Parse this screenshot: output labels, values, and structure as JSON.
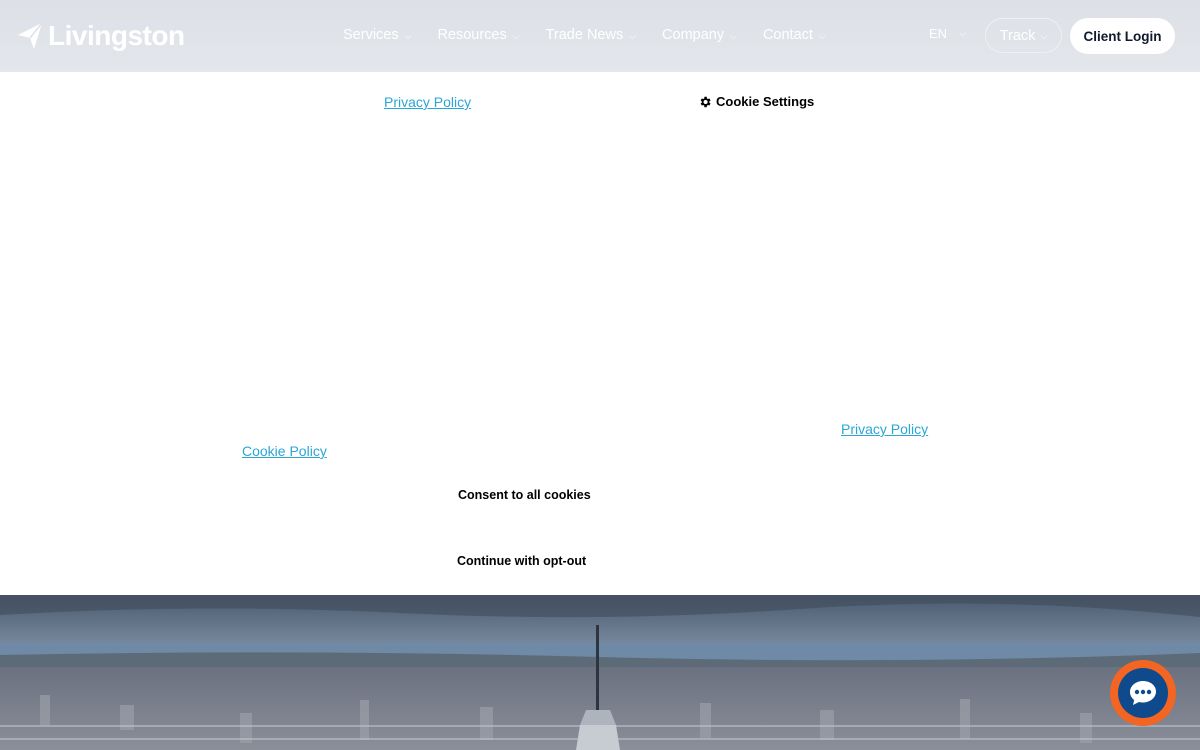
{
  "header": {
    "brand": "Livingston",
    "nav": [
      {
        "label": "Services"
      },
      {
        "label": "Resources"
      },
      {
        "label": "Trade News"
      },
      {
        "label": "Company"
      },
      {
        "label": "Contact"
      }
    ],
    "language": "EN",
    "track_label": "Track",
    "client_login_label": "Client Login",
    "chevron": "⌵"
  },
  "cookie_banner": {
    "privacy_policy_top": "Privacy Policy",
    "cookie_settings_label": "Cookie Settings",
    "privacy_policy_bottom": "Privacy Policy",
    "cookie_policy": "Cookie Policy",
    "consent_all_label": "Consent to all cookies",
    "opt_out_label": "Continue with opt-out"
  },
  "colors": {
    "link": "#2aa6d5",
    "chat_ring": "#f26522",
    "chat_core": "#0e4a8c",
    "login_text": "#101a2c"
  },
  "icons": {
    "logo": "paper-plane-icon",
    "cookie_settings": "gear-icon",
    "chat": "chat-bubble-icon"
  }
}
